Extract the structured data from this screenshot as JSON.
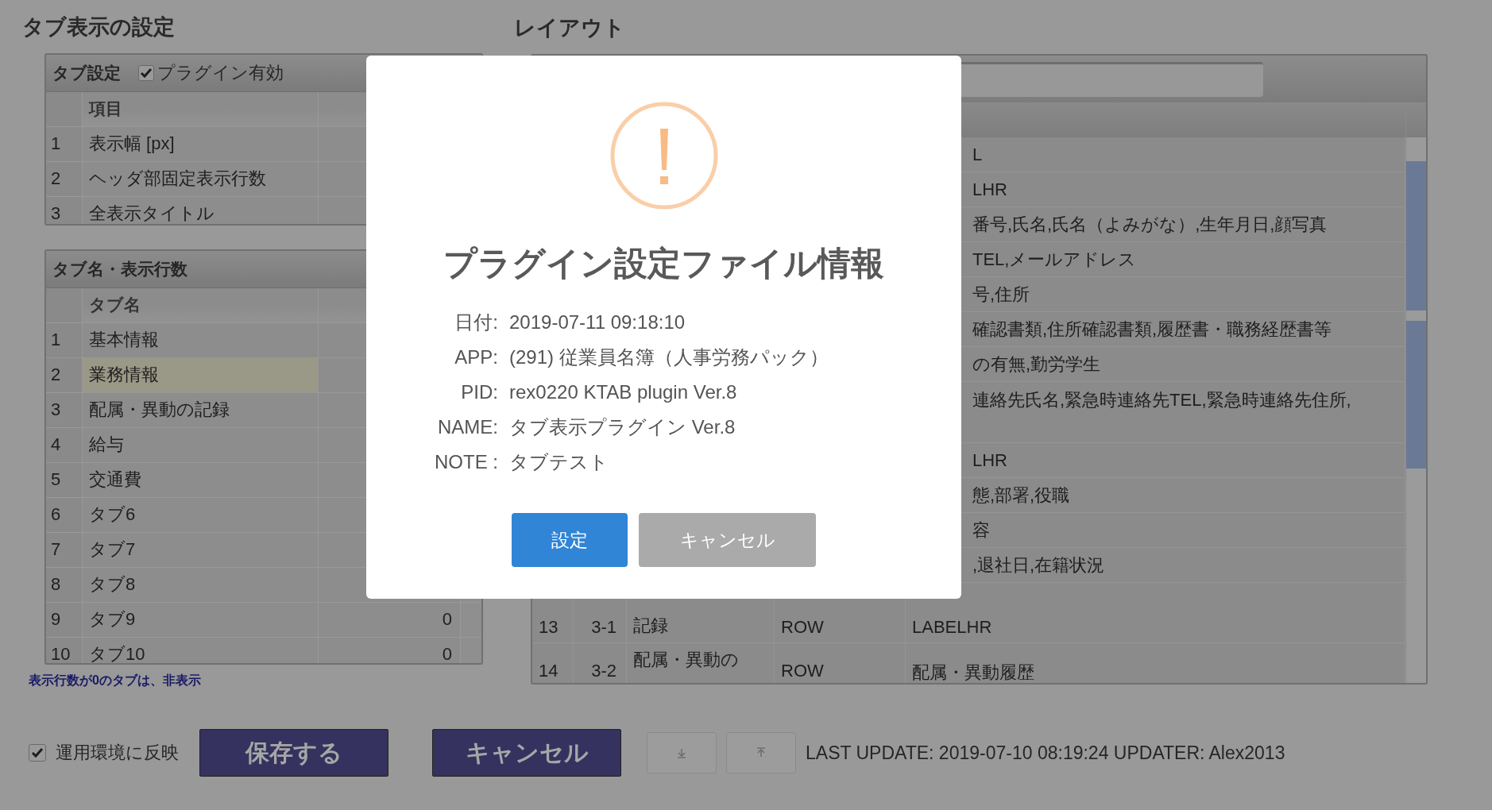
{
  "settings_section": {
    "title": "タブ表示の設定",
    "tab_settings": {
      "title": "タブ設定",
      "plugin_enabled": {
        "label": "プラグイン有効",
        "checked": true
      },
      "columns": [
        "項目"
      ],
      "rows": [
        {
          "number": "1",
          "item": "表示幅 [px]"
        },
        {
          "number": "2",
          "item": "ヘッダ部固定表示行数"
        },
        {
          "number": "3",
          "item": "全表示タイトル"
        }
      ]
    },
    "tab_names": {
      "title": "タブ名・表示行数",
      "columns": [
        "タブ名"
      ],
      "rows": [
        {
          "number": "1",
          "name": "基本情報",
          "selected": false
        },
        {
          "number": "2",
          "name": "業務情報",
          "selected": true
        },
        {
          "number": "3",
          "name": "配属・異動の記録",
          "selected": false
        },
        {
          "number": "4",
          "name": "給与",
          "selected": false
        },
        {
          "number": "5",
          "name": "交通費",
          "selected": false
        },
        {
          "number": "6",
          "name": "タブ6",
          "selected": false
        },
        {
          "number": "7",
          "name": "タブ7",
          "selected": false
        },
        {
          "number": "8",
          "name": "タブ8",
          "selected": false
        },
        {
          "number": "9",
          "name": "タブ9",
          "rows_shown": "0",
          "selected": false
        },
        {
          "number": "10",
          "name": "タブ10",
          "rows_shown": "0",
          "selected": false
        }
      ]
    },
    "hint": "表示行数が0のタブは、非表示"
  },
  "layout_section": {
    "title": "レイアウト",
    "rows": [
      {
        "column_5": "L"
      },
      {
        "column_5": "LHR"
      },
      {
        "column_5": "番号,氏名,氏名（よみがな）,生年月日,顔写真"
      },
      {
        "column_5": "TEL,メールアドレス"
      },
      {
        "column_5": "号,住所"
      },
      {
        "column_5": "確認書類,住所確認書類,履歴書・職務経歴書等"
      },
      {
        "column_5": "の有無,勤労学生"
      },
      {
        "column_5": "連絡先氏名,緊急時連絡先TEL,緊急時連絡先住所,"
      },
      {
        "column_5": "LHR"
      },
      {
        "column_5": "態,部署,役職"
      },
      {
        "column_5": "容"
      },
      {
        "column_5": ",退社日,在籍状況"
      },
      {
        "number": "13",
        "column_2": "3-1",
        "column_3": "記録",
        "column_4": "ROW",
        "column_5": "LABELHR"
      },
      {
        "number": "14",
        "column_2": "3-2",
        "column_3": "配属・異動の",
        "column_4": "ROW",
        "column_5": "配属・異動履歴"
      }
    ]
  },
  "footer": {
    "apply": {
      "label": "運用環境に反映",
      "checked": true
    },
    "buttons": [
      {
        "label": "保存する"
      },
      {
        "label": "キャンセル"
      }
    ],
    "last_update": "LAST UPDATE: 2019-07-10 08:19:24 UPDATER: Alex2013"
  },
  "dialog": {
    "title": "プラグイン設定ファイル情報",
    "fields": [
      {
        "label": "日付:",
        "value": "2019-07-11 09:18:10"
      },
      {
        "label": "APP:",
        "value": "(291) 従業員名簿（人事労務パック）"
      },
      {
        "label": "PID:",
        "value": "rex0220 KTAB plugin Ver.8"
      },
      {
        "label": "NAME:",
        "value": "タブ表示プラグイン Ver.8"
      },
      {
        "label": "NOTE :",
        "value": "タブテスト"
      }
    ],
    "buttons": [
      {
        "label": "設定",
        "kind": "primary"
      },
      {
        "label": "キャンセル",
        "kind": "secondary"
      }
    ]
  }
}
